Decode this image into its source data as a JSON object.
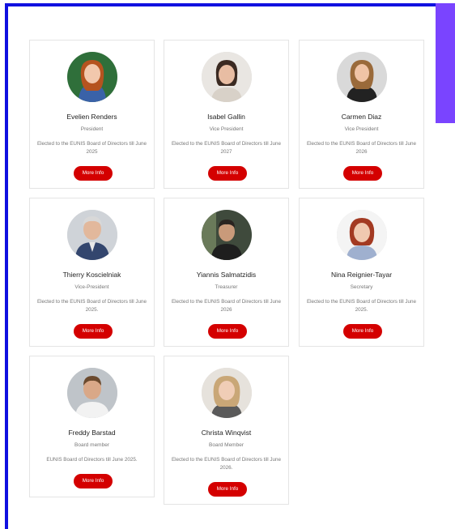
{
  "accent_color": "#d40000",
  "frame_color": "#1010e0",
  "side_tab_color": "#7a44ff",
  "members": [
    {
      "name": "Evelien Renders",
      "role": "President",
      "description": "Elected to the EUNIS Board of Directors till June 2025",
      "button": "More Info"
    },
    {
      "name": "Isabel Gallin",
      "role": "Vice President",
      "description": "Elected to the EUNIS Board of Directors till June 2027",
      "button": "More Info"
    },
    {
      "name": "Carmen Diaz",
      "role": "Vice President",
      "description": "Elected to the EUNIS Board of Directors till June 2026",
      "button": "More Info"
    },
    {
      "name": "Thierry Koscielniak",
      "role": "Vice-President",
      "description": "Elected to the EUNIS Board of Directors till June 2025.",
      "button": "More Info"
    },
    {
      "name": "Yiannis Salmatzidis",
      "role": "Treasurer",
      "description": "Elected to the EUNIS Board of Directors till June 2026",
      "button": "More Info"
    },
    {
      "name": "Nina Reignier-Tayar",
      "role": "Secretary",
      "description": "Elected to the EUNIS Board of Directors till June 2025.",
      "button": "More Info"
    },
    {
      "name": "Freddy Barstad",
      "role": "Board member",
      "description": "EUNIS Board of Directors till June 2025.",
      "button": "More Info"
    },
    {
      "name": "Christa Winqvist",
      "role": "Board Member",
      "description": "Elected to the EUNIS Board of Directors till June 2026.",
      "button": "More Info"
    }
  ]
}
